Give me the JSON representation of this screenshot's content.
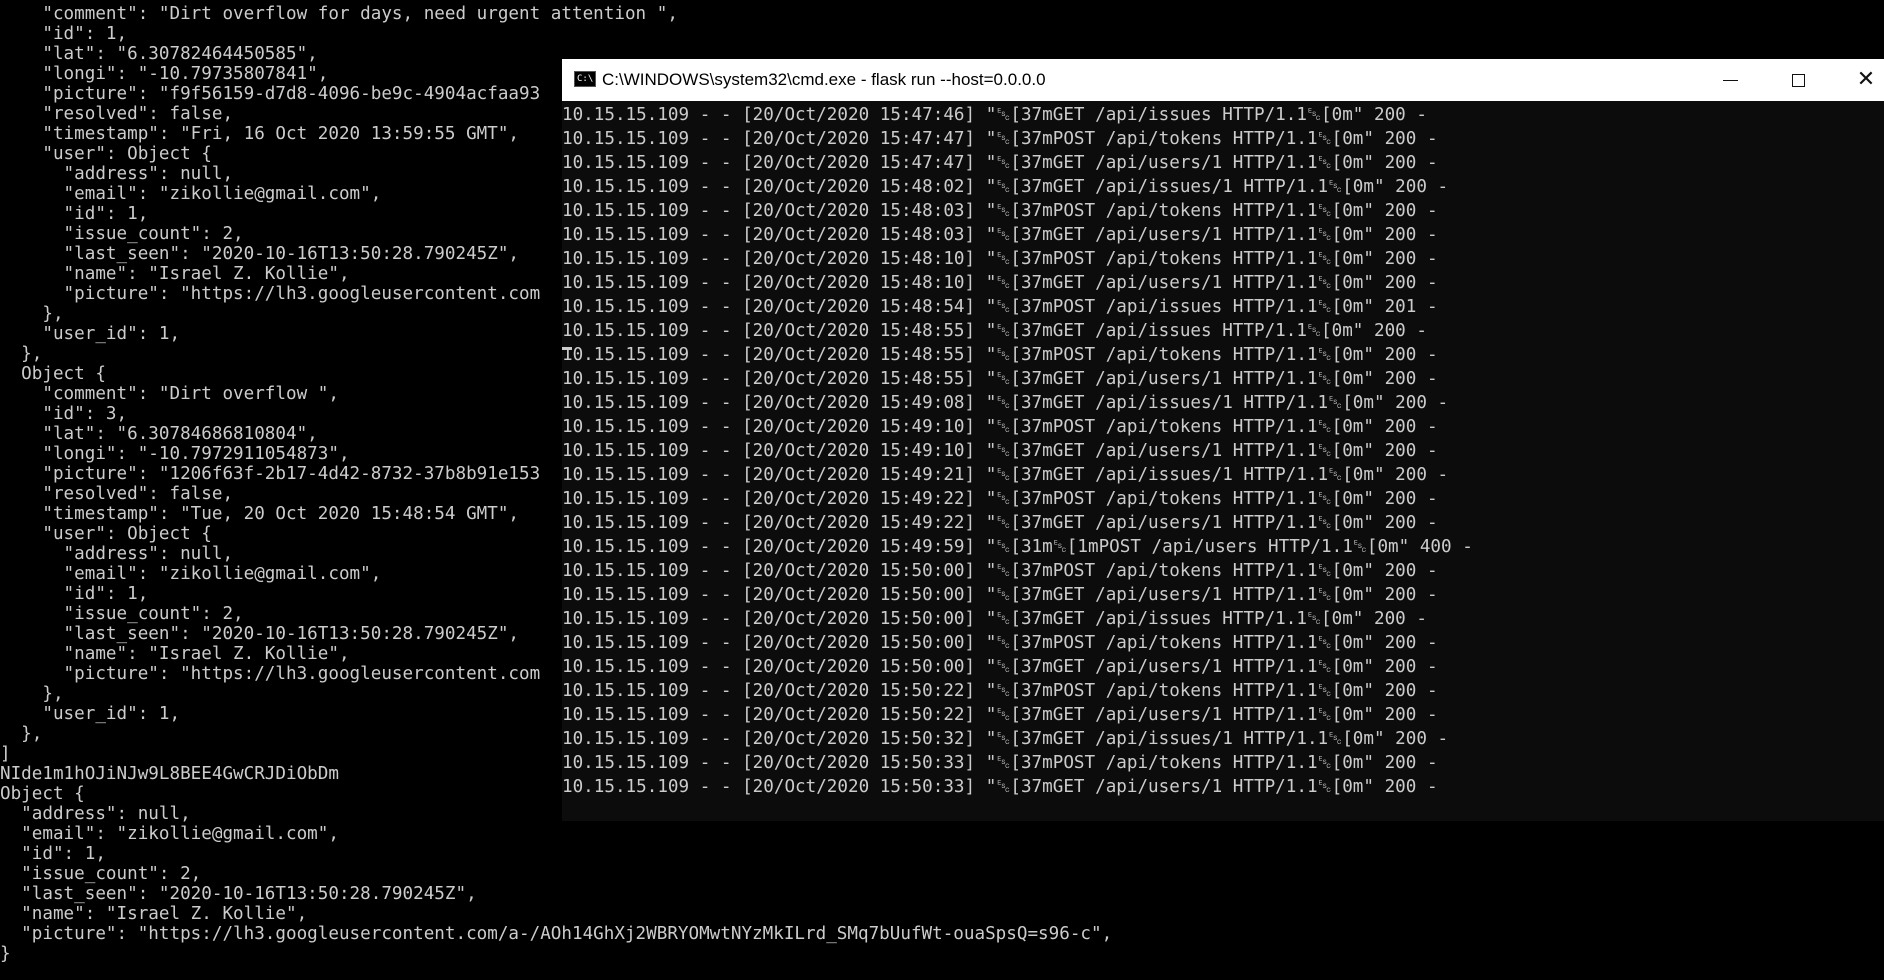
{
  "background_console": {
    "lines": [
      "    \"comment\": \"Dirt overflow for days, need urgent attention \",",
      "    \"id\": 1,",
      "    \"lat\": \"6.30782464450585\",",
      "    \"longi\": \"-10.79735807841\",",
      "    \"picture\": \"f9f56159-d7d8-4096-be9c-4904acfaa93",
      "    \"resolved\": false,",
      "    \"timestamp\": \"Fri, 16 Oct 2020 13:59:55 GMT\",",
      "    \"user\": Object {",
      "      \"address\": null,",
      "      \"email\": \"zikollie@gmail.com\",",
      "      \"id\": 1,",
      "      \"issue_count\": 2,",
      "      \"last_seen\": \"2020-10-16T13:50:28.790245Z\",",
      "      \"name\": \"Israel Z. Kollie\",",
      "      \"picture\": \"https://lh3.googleusercontent.com",
      "    },",
      "    \"user_id\": 1,",
      "  },",
      "  Object {",
      "    \"comment\": \"Dirt overflow \",",
      "    \"id\": 3,",
      "    \"lat\": \"6.30784686810804\",",
      "    \"longi\": \"-10.7972911054873\",",
      "    \"picture\": \"1206f63f-2b17-4d42-8732-37b8b91e153",
      "    \"resolved\": false,",
      "    \"timestamp\": \"Tue, 20 Oct 2020 15:48:54 GMT\",",
      "    \"user\": Object {",
      "      \"address\": null,",
      "      \"email\": \"zikollie@gmail.com\",",
      "      \"id\": 1,",
      "      \"issue_count\": 2,",
      "      \"last_seen\": \"2020-10-16T13:50:28.790245Z\",",
      "      \"name\": \"Israel Z. Kollie\",",
      "      \"picture\": \"https://lh3.googleusercontent.com",
      "    },",
      "    \"user_id\": 1,",
      "  },",
      "]",
      "NIde1m1hOJiNJw9L8BEE4GwCRJDiObDm",
      "Object {",
      "  \"address\": null,",
      "  \"email\": \"zikollie@gmail.com\",",
      "  \"id\": 1,",
      "  \"issue_count\": 2,",
      "  \"last_seen\": \"2020-10-16T13:50:28.790245Z\",",
      "  \"name\": \"Israel Z. Kollie\",",
      "  \"picture\": \"https://lh3.googleusercontent.com/a-/AOh14GhXj2WBRYOMwtNYzMkILrd_SMq7bUufWt-ouaSpsQ=s96-c\",",
      "}"
    ]
  },
  "cmd_window": {
    "title": "C:\\WINDOWS\\system32\\cmd.exe - flask  run --host=0.0.0.0",
    "icon": "cmd-icon",
    "controls": {
      "minimize": "minimize-icon",
      "maximize": "maximize-icon",
      "close": "close-icon"
    },
    "log_lines": [
      "10.15.15.109 - - [20/Oct/2020 15:47:46] \"␛[37mGET /api/issues HTTP/1.1␛[0m\" 200 -",
      "10.15.15.109 - - [20/Oct/2020 15:47:47] \"␛[37mPOST /api/tokens HTTP/1.1␛[0m\" 200 -",
      "10.15.15.109 - - [20/Oct/2020 15:47:47] \"␛[37mGET /api/users/1 HTTP/1.1␛[0m\" 200 -",
      "10.15.15.109 - - [20/Oct/2020 15:48:02] \"␛[37mGET /api/issues/1 HTTP/1.1␛[0m\" 200 -",
      "10.15.15.109 - - [20/Oct/2020 15:48:03] \"␛[37mPOST /api/tokens HTTP/1.1␛[0m\" 200 -",
      "10.15.15.109 - - [20/Oct/2020 15:48:03] \"␛[37mGET /api/users/1 HTTP/1.1␛[0m\" 200 -",
      "10.15.15.109 - - [20/Oct/2020 15:48:10] \"␛[37mPOST /api/tokens HTTP/1.1␛[0m\" 200 -",
      "10.15.15.109 - - [20/Oct/2020 15:48:10] \"␛[37mGET /api/users/1 HTTP/1.1␛[0m\" 200 -",
      "10.15.15.109 - - [20/Oct/2020 15:48:54] \"␛[37mPOST /api/issues HTTP/1.1␛[0m\" 201 -",
      "10.15.15.109 - - [20/Oct/2020 15:48:55] \"␛[37mGET /api/issues HTTP/1.1␛[0m\" 200 -",
      "10.15.15.109 - - [20/Oct/2020 15:48:55] \"␛[37mPOST /api/tokens HTTP/1.1␛[0m\" 200 -",
      "10.15.15.109 - - [20/Oct/2020 15:48:55] \"␛[37mGET /api/users/1 HTTP/1.1␛[0m\" 200 -",
      "10.15.15.109 - - [20/Oct/2020 15:49:08] \"␛[37mGET /api/issues/1 HTTP/1.1␛[0m\" 200 -",
      "10.15.15.109 - - [20/Oct/2020 15:49:10] \"␛[37mPOST /api/tokens HTTP/1.1␛[0m\" 200 -",
      "10.15.15.109 - - [20/Oct/2020 15:49:10] \"␛[37mGET /api/users/1 HTTP/1.1␛[0m\" 200 -",
      "10.15.15.109 - - [20/Oct/2020 15:49:21] \"␛[37mGET /api/issues/1 HTTP/1.1␛[0m\" 200 -",
      "10.15.15.109 - - [20/Oct/2020 15:49:22] \"␛[37mPOST /api/tokens HTTP/1.1␛[0m\" 200 -",
      "10.15.15.109 - - [20/Oct/2020 15:49:22] \"␛[37mGET /api/users/1 HTTP/1.1␛[0m\" 200 -",
      "10.15.15.109 - - [20/Oct/2020 15:49:59] \"␛[31m␛[1mPOST /api/users HTTP/1.1␛[0m\" 400 -",
      "10.15.15.109 - - [20/Oct/2020 15:50:00] \"␛[37mPOST /api/tokens HTTP/1.1␛[0m\" 200 -",
      "10.15.15.109 - - [20/Oct/2020 15:50:00] \"␛[37mGET /api/users/1 HTTP/1.1␛[0m\" 200 -",
      "10.15.15.109 - - [20/Oct/2020 15:50:00] \"␛[37mGET /api/issues HTTP/1.1␛[0m\" 200 -",
      "10.15.15.109 - - [20/Oct/2020 15:50:00] \"␛[37mPOST /api/tokens HTTP/1.1␛[0m\" 200 -",
      "10.15.15.109 - - [20/Oct/2020 15:50:00] \"␛[37mGET /api/users/1 HTTP/1.1␛[0m\" 200 -",
      "10.15.15.109 - - [20/Oct/2020 15:50:22] \"␛[37mPOST /api/tokens HTTP/1.1␛[0m\" 200 -",
      "10.15.15.109 - - [20/Oct/2020 15:50:22] \"␛[37mGET /api/users/1 HTTP/1.1␛[0m\" 200 -",
      "10.15.15.109 - - [20/Oct/2020 15:50:32] \"␛[37mGET /api/issues/1 HTTP/1.1␛[0m\" 200 -",
      "10.15.15.109 - - [20/Oct/2020 15:50:33] \"␛[37mPOST /api/tokens HTTP/1.1␛[0m\" 200 -",
      "10.15.15.109 - - [20/Oct/2020 15:50:33] \"␛[37mGET /api/users/1 HTTP/1.1␛[0m\" 200 -"
    ]
  },
  "colors": {
    "console_background": "#000000",
    "console_text": "#cccccc",
    "titlebar": "#ffffff"
  }
}
